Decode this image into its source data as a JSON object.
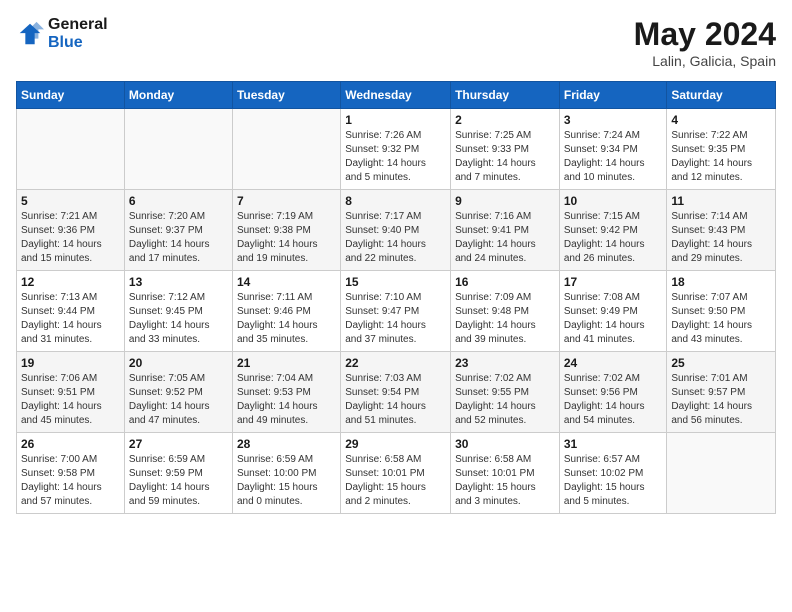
{
  "header": {
    "logo_line1": "General",
    "logo_line2": "Blue",
    "month_year": "May 2024",
    "location": "Lalin, Galicia, Spain"
  },
  "weekdays": [
    "Sunday",
    "Monday",
    "Tuesday",
    "Wednesday",
    "Thursday",
    "Friday",
    "Saturday"
  ],
  "weeks": [
    [
      {
        "day": "",
        "info": ""
      },
      {
        "day": "",
        "info": ""
      },
      {
        "day": "",
        "info": ""
      },
      {
        "day": "1",
        "info": "Sunrise: 7:26 AM\nSunset: 9:32 PM\nDaylight: 14 hours\nand 5 minutes."
      },
      {
        "day": "2",
        "info": "Sunrise: 7:25 AM\nSunset: 9:33 PM\nDaylight: 14 hours\nand 7 minutes."
      },
      {
        "day": "3",
        "info": "Sunrise: 7:24 AM\nSunset: 9:34 PM\nDaylight: 14 hours\nand 10 minutes."
      },
      {
        "day": "4",
        "info": "Sunrise: 7:22 AM\nSunset: 9:35 PM\nDaylight: 14 hours\nand 12 minutes."
      }
    ],
    [
      {
        "day": "5",
        "info": "Sunrise: 7:21 AM\nSunset: 9:36 PM\nDaylight: 14 hours\nand 15 minutes."
      },
      {
        "day": "6",
        "info": "Sunrise: 7:20 AM\nSunset: 9:37 PM\nDaylight: 14 hours\nand 17 minutes."
      },
      {
        "day": "7",
        "info": "Sunrise: 7:19 AM\nSunset: 9:38 PM\nDaylight: 14 hours\nand 19 minutes."
      },
      {
        "day": "8",
        "info": "Sunrise: 7:17 AM\nSunset: 9:40 PM\nDaylight: 14 hours\nand 22 minutes."
      },
      {
        "day": "9",
        "info": "Sunrise: 7:16 AM\nSunset: 9:41 PM\nDaylight: 14 hours\nand 24 minutes."
      },
      {
        "day": "10",
        "info": "Sunrise: 7:15 AM\nSunset: 9:42 PM\nDaylight: 14 hours\nand 26 minutes."
      },
      {
        "day": "11",
        "info": "Sunrise: 7:14 AM\nSunset: 9:43 PM\nDaylight: 14 hours\nand 29 minutes."
      }
    ],
    [
      {
        "day": "12",
        "info": "Sunrise: 7:13 AM\nSunset: 9:44 PM\nDaylight: 14 hours\nand 31 minutes."
      },
      {
        "day": "13",
        "info": "Sunrise: 7:12 AM\nSunset: 9:45 PM\nDaylight: 14 hours\nand 33 minutes."
      },
      {
        "day": "14",
        "info": "Sunrise: 7:11 AM\nSunset: 9:46 PM\nDaylight: 14 hours\nand 35 minutes."
      },
      {
        "day": "15",
        "info": "Sunrise: 7:10 AM\nSunset: 9:47 PM\nDaylight: 14 hours\nand 37 minutes."
      },
      {
        "day": "16",
        "info": "Sunrise: 7:09 AM\nSunset: 9:48 PM\nDaylight: 14 hours\nand 39 minutes."
      },
      {
        "day": "17",
        "info": "Sunrise: 7:08 AM\nSunset: 9:49 PM\nDaylight: 14 hours\nand 41 minutes."
      },
      {
        "day": "18",
        "info": "Sunrise: 7:07 AM\nSunset: 9:50 PM\nDaylight: 14 hours\nand 43 minutes."
      }
    ],
    [
      {
        "day": "19",
        "info": "Sunrise: 7:06 AM\nSunset: 9:51 PM\nDaylight: 14 hours\nand 45 minutes."
      },
      {
        "day": "20",
        "info": "Sunrise: 7:05 AM\nSunset: 9:52 PM\nDaylight: 14 hours\nand 47 minutes."
      },
      {
        "day": "21",
        "info": "Sunrise: 7:04 AM\nSunset: 9:53 PM\nDaylight: 14 hours\nand 49 minutes."
      },
      {
        "day": "22",
        "info": "Sunrise: 7:03 AM\nSunset: 9:54 PM\nDaylight: 14 hours\nand 51 minutes."
      },
      {
        "day": "23",
        "info": "Sunrise: 7:02 AM\nSunset: 9:55 PM\nDaylight: 14 hours\nand 52 minutes."
      },
      {
        "day": "24",
        "info": "Sunrise: 7:02 AM\nSunset: 9:56 PM\nDaylight: 14 hours\nand 54 minutes."
      },
      {
        "day": "25",
        "info": "Sunrise: 7:01 AM\nSunset: 9:57 PM\nDaylight: 14 hours\nand 56 minutes."
      }
    ],
    [
      {
        "day": "26",
        "info": "Sunrise: 7:00 AM\nSunset: 9:58 PM\nDaylight: 14 hours\nand 57 minutes."
      },
      {
        "day": "27",
        "info": "Sunrise: 6:59 AM\nSunset: 9:59 PM\nDaylight: 14 hours\nand 59 minutes."
      },
      {
        "day": "28",
        "info": "Sunrise: 6:59 AM\nSunset: 10:00 PM\nDaylight: 15 hours\nand 0 minutes."
      },
      {
        "day": "29",
        "info": "Sunrise: 6:58 AM\nSunset: 10:01 PM\nDaylight: 15 hours\nand 2 minutes."
      },
      {
        "day": "30",
        "info": "Sunrise: 6:58 AM\nSunset: 10:01 PM\nDaylight: 15 hours\nand 3 minutes."
      },
      {
        "day": "31",
        "info": "Sunrise: 6:57 AM\nSunset: 10:02 PM\nDaylight: 15 hours\nand 5 minutes."
      },
      {
        "day": "",
        "info": ""
      }
    ]
  ]
}
